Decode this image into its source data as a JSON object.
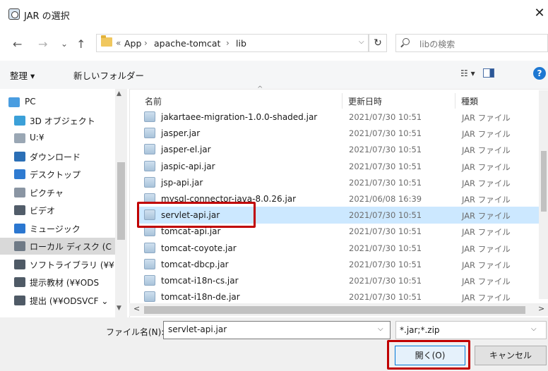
{
  "window": {
    "title": "JAR の選択",
    "close_glyph": "✕"
  },
  "nav_buttons": {
    "back": "←",
    "forward": "→",
    "recent": "⌄",
    "up": "↑"
  },
  "address": {
    "overflow": "«",
    "crumbs": [
      "App",
      "apache-tomcat",
      "lib"
    ],
    "separator": "›",
    "dropdown": "⌵",
    "refresh": "↻"
  },
  "search": {
    "placeholder": "libの検索"
  },
  "toolbar": {
    "organize": "整理 ▾",
    "new_folder": "新しいフォルダー",
    "view": "☷ ▾",
    "help": "?"
  },
  "nav_pane": [
    {
      "label": "PC",
      "icon": "pc-icon",
      "color": "#4a9de0"
    },
    {
      "label": "3D オブジェクト",
      "icon": "3d-objects-icon",
      "color": "#3ba0d8"
    },
    {
      "label": "U:¥",
      "icon": "drive-icon",
      "color": "#9aa7b4"
    },
    {
      "label": "ダウンロード",
      "icon": "download-icon",
      "color": "#2b6fb6"
    },
    {
      "label": "デスクトップ",
      "icon": "desktop-icon",
      "color": "#2f7bd1"
    },
    {
      "label": "ピクチャ",
      "icon": "pictures-icon",
      "color": "#8a95a3"
    },
    {
      "label": "ビデオ",
      "icon": "videos-icon",
      "color": "#525d6a"
    },
    {
      "label": "ミュージック",
      "icon": "music-icon",
      "color": "#2b77d0"
    },
    {
      "label": "ローカル ディスク (C",
      "icon": "local-disk-icon",
      "color": "#6f7a86"
    },
    {
      "label": "ソフトライブラリ (¥¥",
      "icon": "network-drive-icon",
      "color": "#4f5a66"
    },
    {
      "label": "提示教材 (¥¥ODS",
      "icon": "network-drive-icon",
      "color": "#4f5a66"
    },
    {
      "label": "提出 (¥¥ODSVCF ⌄",
      "icon": "network-drive-icon",
      "color": "#4f5a66"
    }
  ],
  "columns": {
    "name": "名前",
    "date": "更新日時",
    "type": "種類",
    "sort_glyph": "^"
  },
  "files": [
    {
      "name": "jakartaee-migration-1.0.0-shaded.jar",
      "date": "2021/07/30 10:51",
      "type": "JAR ファイル"
    },
    {
      "name": "jasper.jar",
      "date": "2021/07/30 10:51",
      "type": "JAR ファイル"
    },
    {
      "name": "jasper-el.jar",
      "date": "2021/07/30 10:51",
      "type": "JAR ファイル"
    },
    {
      "name": "jaspic-api.jar",
      "date": "2021/07/30 10:51",
      "type": "JAR ファイル"
    },
    {
      "name": "jsp-api.jar",
      "date": "2021/07/30 10:51",
      "type": "JAR ファイル"
    },
    {
      "name": "mysql-connector-java-8.0.26.jar",
      "date": "2021/06/08 16:39",
      "type": "JAR ファイル"
    },
    {
      "name": "servlet-api.jar",
      "date": "2021/07/30 10:51",
      "type": "JAR ファイル"
    },
    {
      "name": "tomcat-api.jar",
      "date": "2021/07/30 10:51",
      "type": "JAR ファイル"
    },
    {
      "name": "tomcat-coyote.jar",
      "date": "2021/07/30 10:51",
      "type": "JAR ファイル"
    },
    {
      "name": "tomcat-dbcp.jar",
      "date": "2021/07/30 10:51",
      "type": "JAR ファイル"
    },
    {
      "name": "tomcat-i18n-cs.jar",
      "date": "2021/07/30 10:51",
      "type": "JAR ファイル"
    },
    {
      "name": "tomcat-i18n-de.jar",
      "date": "2021/07/30 10:51",
      "type": "JAR ファイル"
    }
  ],
  "selected_file": "servlet-api.jar",
  "scroll_glyphs": {
    "up": "▲",
    "down": "▼",
    "left": "<",
    "right": ">"
  },
  "bottom": {
    "filename_label": "ファイル名(N):",
    "filename_value": "servlet-api.jar",
    "dropdown": "⌵",
    "filter": "*.jar;*.zip",
    "open": "開く(O)",
    "cancel": "キャンセル"
  },
  "colors": {
    "selection": "#cce8ff",
    "highlight": "#c00000",
    "accent": "#0078d7"
  }
}
